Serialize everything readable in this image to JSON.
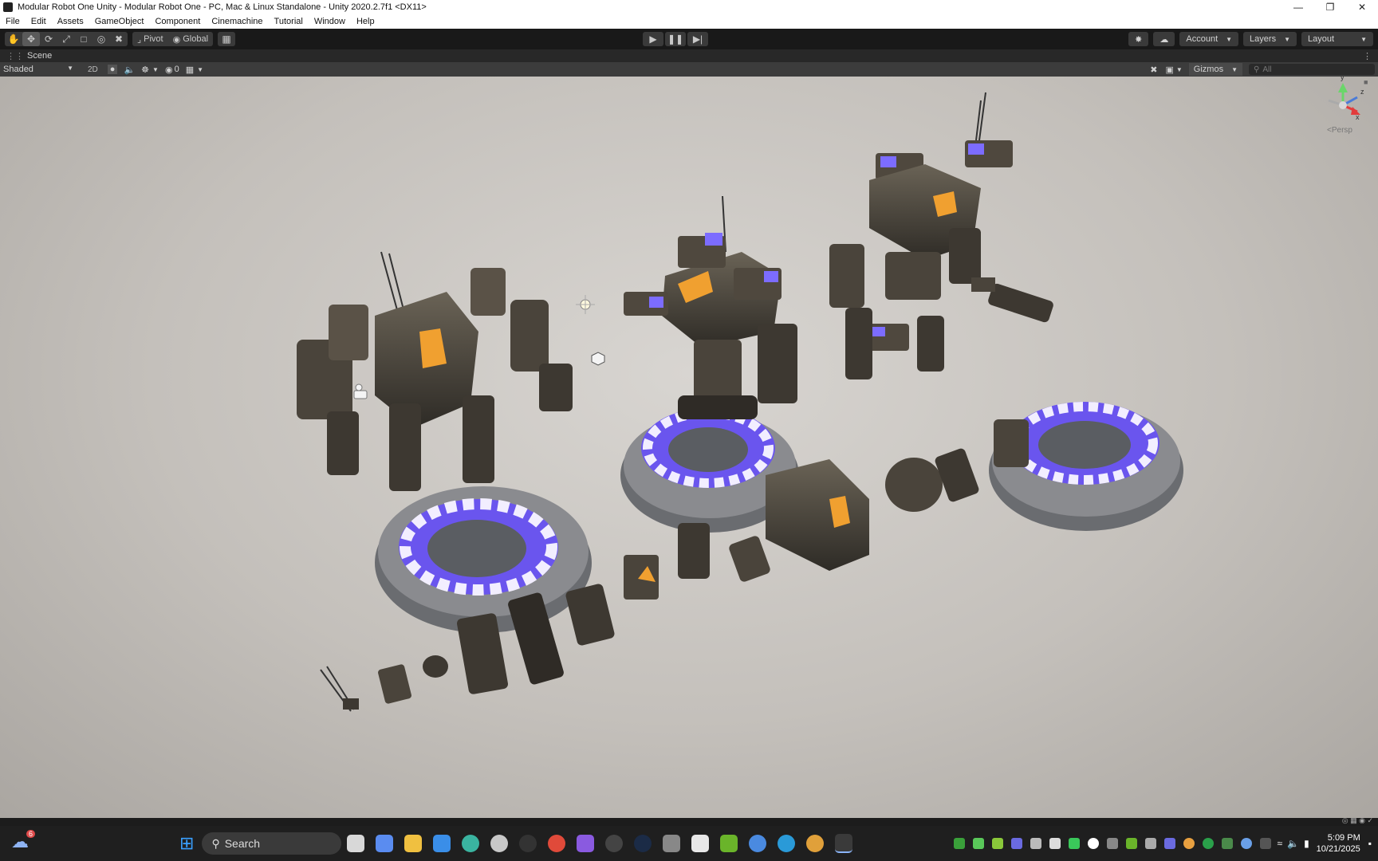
{
  "window": {
    "title": "Modular Robot One Unity - Modular Robot One - PC, Mac & Linux Standalone - Unity 2020.2.7f1 <DX11>"
  },
  "menu": [
    "File",
    "Edit",
    "Assets",
    "GameObject",
    "Component",
    "Cinemachine",
    "Tutorial",
    "Window",
    "Help"
  ],
  "toolbar": {
    "pivot_label": "Pivot",
    "global_label": "Global",
    "account_label": "Account",
    "layers_label": "Layers",
    "layout_label": "Layout"
  },
  "scene": {
    "tab_label": "Scene",
    "shading_mode": "Shaded",
    "mode_2d_label": "2D",
    "hidden_count": "0",
    "gizmos_label": "Gizmos",
    "search_placeholder": "All",
    "axis_y": "y",
    "axis_x": "x",
    "axis_z": "z",
    "projection_label": "Persp"
  },
  "taskbar": {
    "search_label": "Search",
    "weather_badge": "6",
    "time": "5:09 PM",
    "date": "10/21/2025"
  },
  "colors": {
    "editor_bg": "#1e1e1e",
    "toolbar_bg": "#191919",
    "ground": "#c8c4bf",
    "pad_glow": "#7766ff",
    "accent_orange": "#f0a030"
  }
}
